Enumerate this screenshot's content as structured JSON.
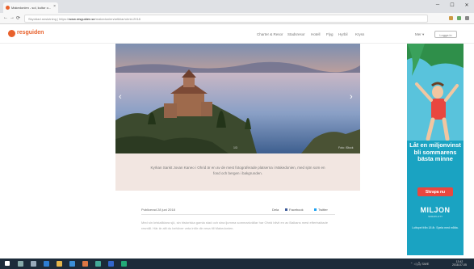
{
  "browser": {
    "tab_title": "Makedonien - sol, kultur o...",
    "tab_close": "×",
    "url_prefix": "Skyddad anslutning | https://",
    "url_domain": "www.resguiden.se",
    "url_path": "/makedonien/artiklar/ohrid-2018",
    "win_min": "─",
    "win_max": "☐",
    "win_close": "✕",
    "back": "←",
    "forward": "→",
    "reload": "⟳"
  },
  "site": {
    "logo": "resguiden",
    "nav": [
      "Charter & Resor",
      "Stadsresor",
      "Hotell",
      "Flyg",
      "Hyrbil",
      "Kryss",
      "Mer ▾"
    ],
    "login": "Logga in"
  },
  "hero": {
    "prev_icon": "‹",
    "next_icon": "›",
    "credit_left": "1/3",
    "credit_right": "Foto: iStock"
  },
  "caption": "Kyrkan Sankt Jovan Kaneo i Ohrid är en av de mest fotograferade platserna i Makedonien, med sjön som en fond och bergen i bakgrunden.",
  "article": {
    "date": "Publicerad 28 juni 2018",
    "share_label": "Dela",
    "facebook": "Facebook",
    "twitter": "Twitter",
    "body": "Med sin kristallklara sjö, sin historiska gamla stad och sina ljumma sommarkvällar har Ohrid blivit en av Balkans mest eftertraktade resmål. Här är allt du behöver veta inför din resa till Makedonien."
  },
  "ad": {
    "headline": "Låt en miljonvinst bli sommarens bästa minne",
    "cta": "Skrapa nu",
    "brand": "MILJON",
    "brand_sub": "SKRAPLOTT",
    "small": "Lottspel från 18 år. Spela med måtta."
  },
  "taskbar": {
    "time": "13:42",
    "date": "2018-07-05",
    "tray": "⌃ ◁ 🖧 SWE"
  },
  "colors": {
    "brand": "#e8612c",
    "caption_bg": "#f2e6e1",
    "ad_bg": "#1aa3c2",
    "ad_cta": "#e9473f",
    "taskbar": "#1c2b3a"
  }
}
